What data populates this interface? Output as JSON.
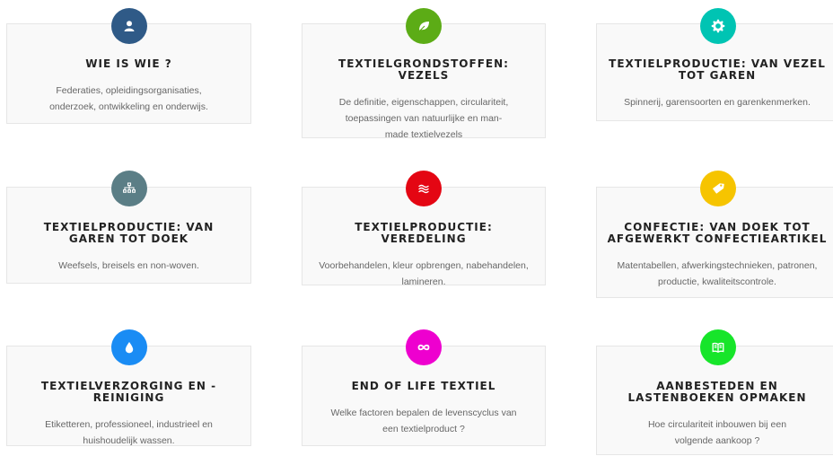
{
  "cards": [
    {
      "title": "WIE IS WIE ?",
      "desc": "Federaties, opleidingsorganisaties, onderzoek, ontwikkeling en onderwijs.",
      "icon": "user-icon",
      "color": "#2f5a87"
    },
    {
      "title": "TEXTIELGRONDSTOFFEN: VEZELS",
      "desc": "De definitie, eigenschappen, circulariteit, toepassingen van natuurlijke en man-made textielvezels",
      "icon": "leaf-icon",
      "color": "#5cac16"
    },
    {
      "title": "TEXTIELPRODUCTIE: VAN VEZEL TOT GAREN",
      "desc": "Spinnerij, garensoorten en garenkenmerken.",
      "icon": "gear-icon",
      "color": "#00c4b3"
    },
    {
      "title": "TEXTIELPRODUCTIE: VAN GAREN TOT DOEK",
      "desc": "Weefsels, breisels en non-woven.",
      "icon": "sitemap-icon",
      "color": "#5b7e86"
    },
    {
      "title": "TEXTIELPRODUCTIE: VEREDELING",
      "desc": "Voorbehandelen, kleur opbrengen, nabehandelen, lamineren.",
      "icon": "waves-icon",
      "color": "#e40613"
    },
    {
      "title": "CONFECTIE: VAN DOEK TOT AFGEWERKT CONFECTIEARTIKEL",
      "desc": "Matentabellen, afwerkingstechnieken, patronen, productie, kwaliteitscontrole.",
      "icon": "tag-icon",
      "color": "#f6c400"
    },
    {
      "title": "TEXTIELVERZORGING EN -REINIGING",
      "desc": "Etiketteren, professioneel, industrieel en huishoudelijk wassen.",
      "icon": "drop-icon",
      "color": "#1a8cf4"
    },
    {
      "title": "END OF LIFE TEXTIEL",
      "desc": "Welke factoren bepalen de levenscyclus van een textielproduct ?",
      "icon": "infinity-icon",
      "color": "#ee00cf"
    },
    {
      "title": "AANBESTEDEN EN LASTENBOEKEN OPMAKEN",
      "desc": "Hoe circulariteit inbouwen bij een volgende aankoop ?",
      "icon": "book-icon",
      "color": "#17e52a"
    }
  ]
}
